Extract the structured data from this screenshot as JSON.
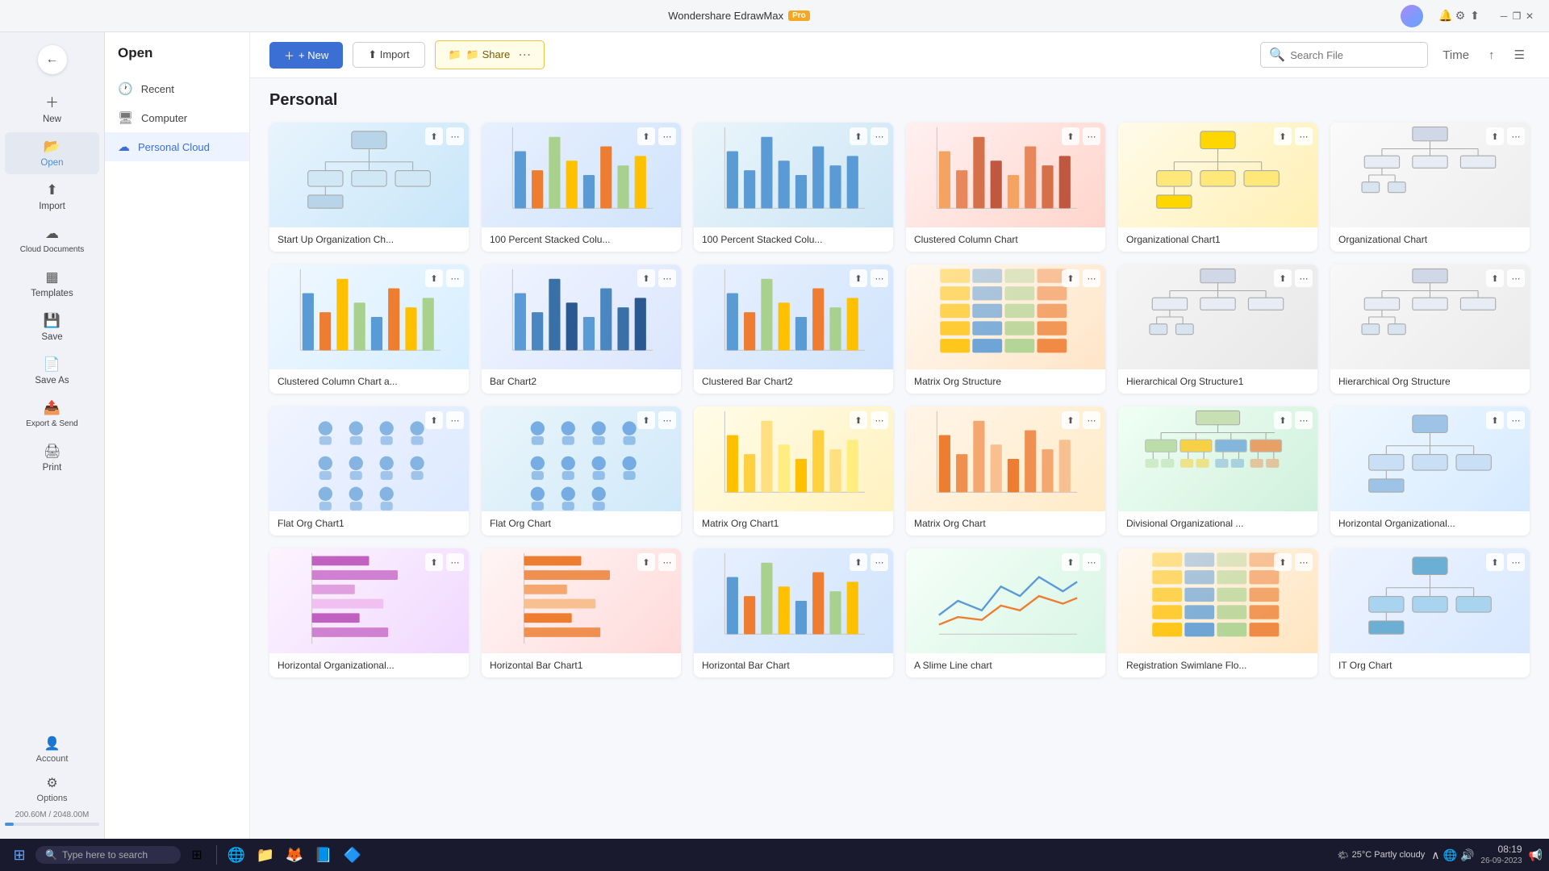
{
  "app": {
    "title": "Wondershare EdrawMax",
    "pro_badge": "Pro"
  },
  "titlebar": {
    "minimize": "─",
    "restore": "❐",
    "close": "✕"
  },
  "sidebar": {
    "items": [
      {
        "id": "new",
        "label": "New",
        "icon": "＋"
      },
      {
        "id": "open",
        "label": "Open",
        "icon": "📂"
      },
      {
        "id": "import",
        "label": "Import",
        "icon": "⬆"
      },
      {
        "id": "cloud",
        "label": "Cloud Documents",
        "icon": "☁"
      },
      {
        "id": "templates",
        "label": "Templates",
        "icon": "▦"
      },
      {
        "id": "save",
        "label": "Save",
        "icon": "💾"
      },
      {
        "id": "saveas",
        "label": "Save As",
        "icon": "📄"
      },
      {
        "id": "export",
        "label": "Export & Send",
        "icon": "📤"
      },
      {
        "id": "print",
        "label": "Print",
        "icon": "🖨"
      }
    ],
    "bottom": [
      {
        "id": "account",
        "label": "Account",
        "icon": "👤"
      },
      {
        "id": "options",
        "label": "Options",
        "icon": "⚙"
      }
    ],
    "storage": "200.60M / 2048.00M",
    "storage_progress": 9.8
  },
  "left_panel": {
    "title": "Open",
    "nav_items": [
      {
        "id": "recent",
        "label": "Recent",
        "icon": "🕐"
      },
      {
        "id": "computer",
        "label": "Computer",
        "icon": "🖥"
      },
      {
        "id": "personal_cloud",
        "label": "Personal Cloud",
        "icon": "☁",
        "active": true
      }
    ]
  },
  "topbar": {
    "new_label": "+ New",
    "import_label": "⬆ Import",
    "share_label": "📁 Share",
    "search_placeholder": "Search File",
    "sort_label": "Time"
  },
  "page": {
    "title": "Personal"
  },
  "cards": [
    {
      "id": 1,
      "label": "Start Up Organization Ch...",
      "thumb_class": "thumb-org"
    },
    {
      "id": 2,
      "label": "100 Percent Stacked Colu...",
      "thumb_class": "thumb-bar-blue"
    },
    {
      "id": 3,
      "label": "100 Percent Stacked Colu...",
      "thumb_class": "thumb-bar-blue2"
    },
    {
      "id": 4,
      "label": "Clustered Column Chart",
      "thumb_class": "thumb-bar-pink"
    },
    {
      "id": 5,
      "label": "Organizational Chart1",
      "thumb_class": "thumb-org-yellow"
    },
    {
      "id": 6,
      "label": "Organizational Chart",
      "thumb_class": "thumb-org-white"
    },
    {
      "id": 7,
      "label": "Clustered Column Chart a...",
      "thumb_class": "thumb-bar-mixed"
    },
    {
      "id": 8,
      "label": "Bar Chart2",
      "thumb_class": "thumb-bar-chart2"
    },
    {
      "id": 9,
      "label": "Clustered Bar Chart2",
      "thumb_class": "thumb-bar-blue"
    },
    {
      "id": 10,
      "label": "Matrix Org Structure",
      "thumb_class": "thumb-matrix"
    },
    {
      "id": 11,
      "label": "Hierarchical Org Structure1",
      "thumb_class": "thumb-hier1"
    },
    {
      "id": 12,
      "label": "Hierarchical Org Structure",
      "thumb_class": "thumb-hier2"
    },
    {
      "id": 13,
      "label": "Flat Org Chart1",
      "thumb_class": "thumb-flat-people"
    },
    {
      "id": 14,
      "label": "Flat Org Chart",
      "thumb_class": "thumb-flat-people2"
    },
    {
      "id": 15,
      "label": "Matrix Org Chart1",
      "thumb_class": "thumb-matrix-col"
    },
    {
      "id": 16,
      "label": "Matrix Org Chart",
      "thumb_class": "thumb-matrix-col2"
    },
    {
      "id": 17,
      "label": "Divisional Organizational ...",
      "thumb_class": "thumb-divisional"
    },
    {
      "id": 18,
      "label": "Horizontal Organizational...",
      "thumb_class": "thumb-horizontal"
    },
    {
      "id": 19,
      "label": "Horizontal Organizational...",
      "thumb_class": "thumb-horiz-bar"
    },
    {
      "id": 20,
      "label": "Horizontal Bar Chart1",
      "thumb_class": "thumb-horiz-bar2"
    },
    {
      "id": 21,
      "label": "Horizontal Bar Chart",
      "thumb_class": "thumb-bar-blue"
    },
    {
      "id": 22,
      "label": "A Slime Line chart",
      "thumb_class": "thumb-line"
    },
    {
      "id": 23,
      "label": "Registration Swimlane Flo...",
      "thumb_class": "thumb-swimlane"
    },
    {
      "id": 24,
      "label": "IT Org Chart",
      "thumb_class": "thumb-it-org"
    }
  ],
  "taskbar": {
    "search_placeholder": "Type here to search",
    "time": "08:19",
    "date": "26-09-2023",
    "weather": "25°C  Partly cloudy",
    "apps": [
      "🪟",
      "🔍",
      "🗂",
      "🌐",
      "📁",
      "🦊",
      "📝",
      "📘",
      "🔷"
    ]
  }
}
